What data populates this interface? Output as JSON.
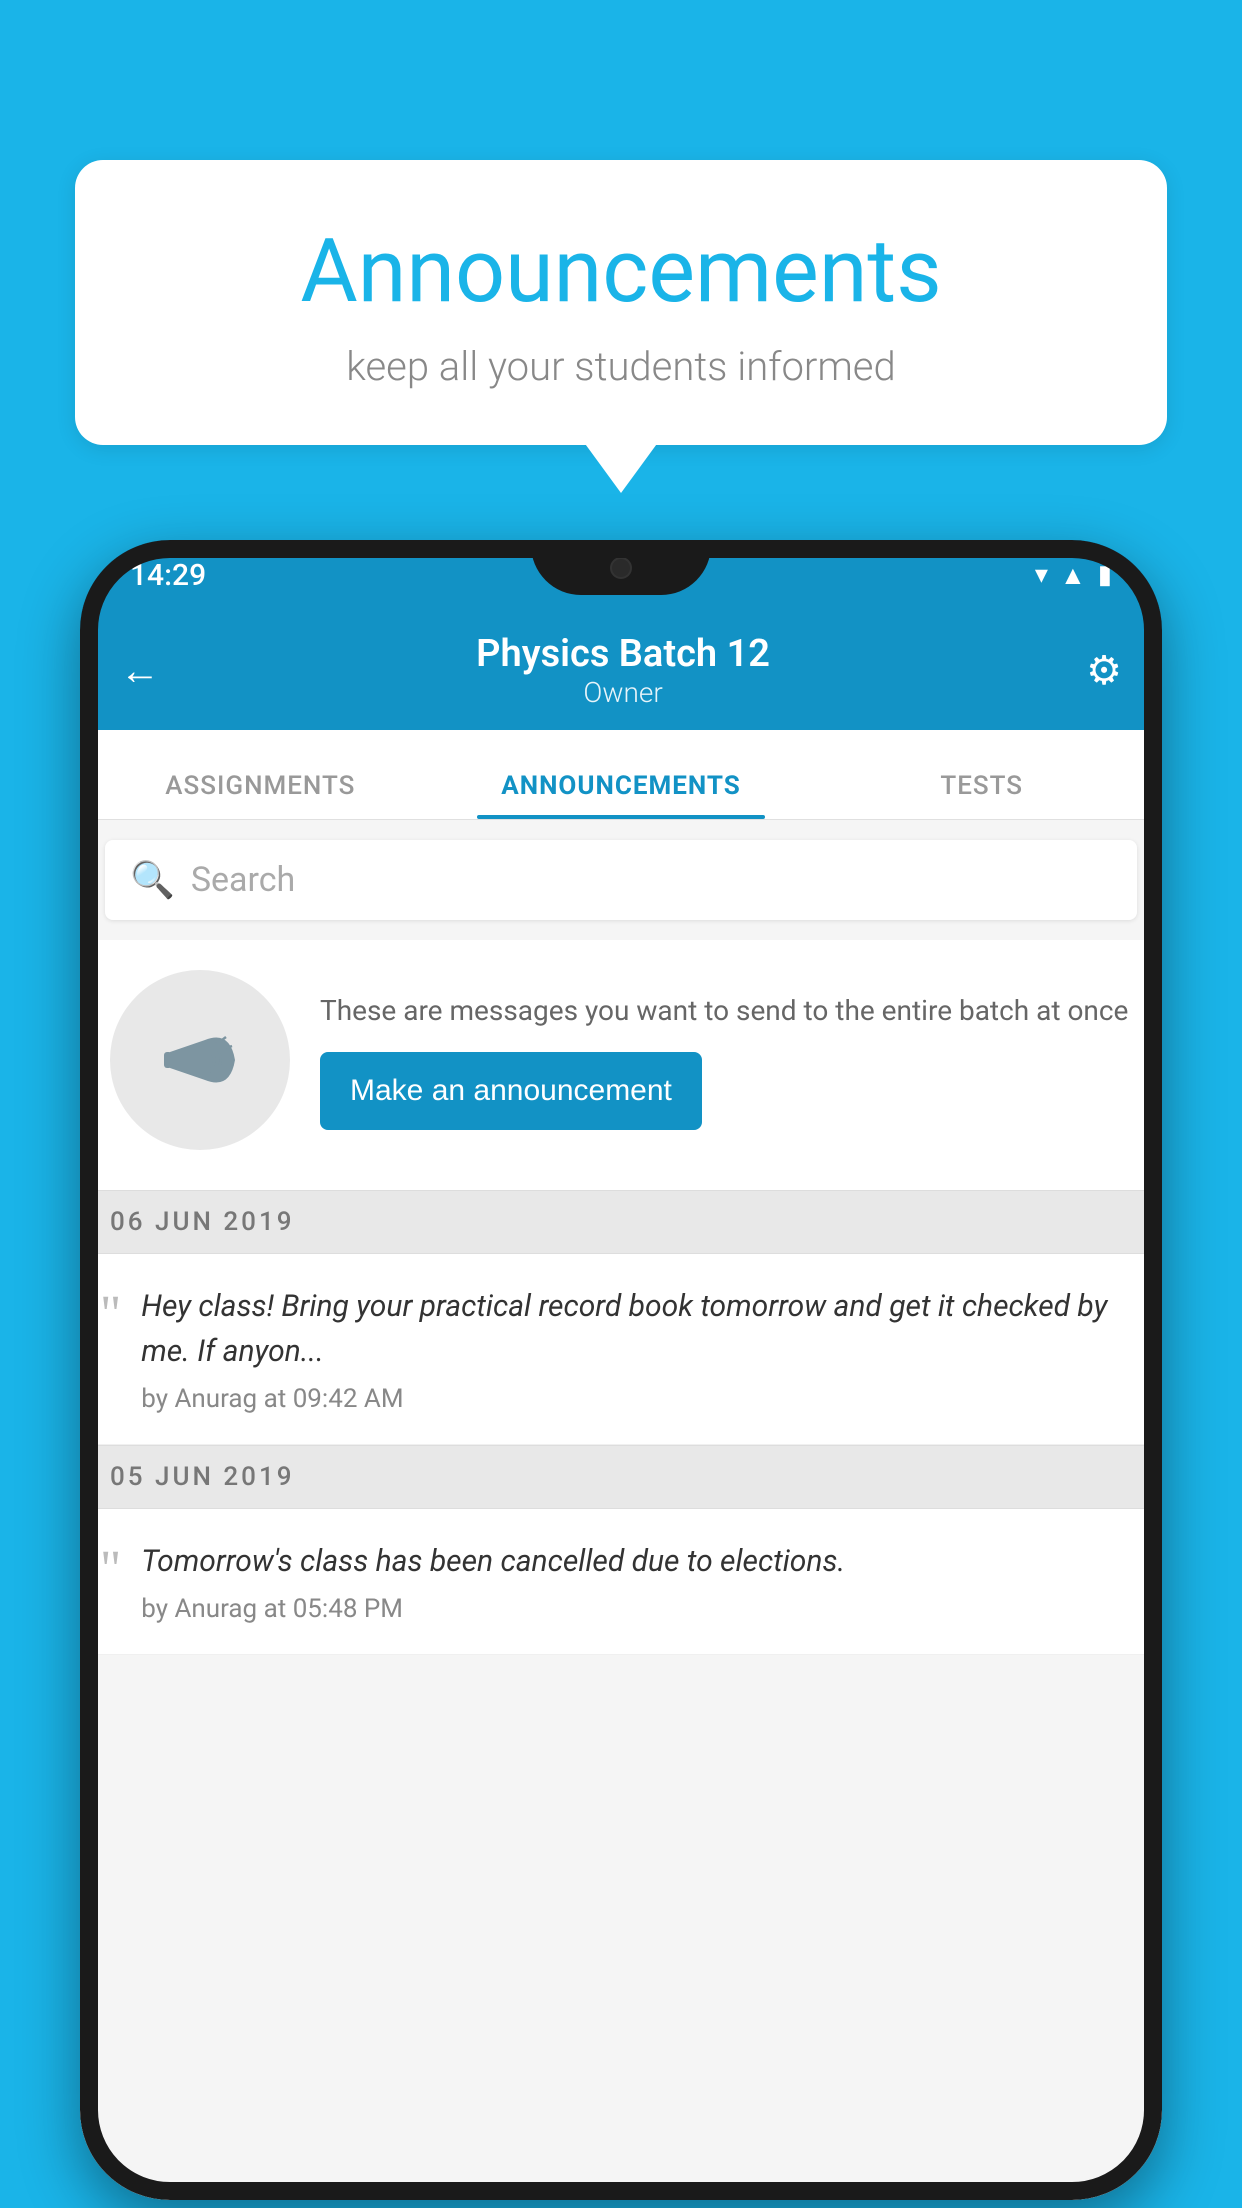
{
  "background_color": "#1ab4e8",
  "speech_bubble": {
    "title": "Announcements",
    "subtitle": "keep all your students informed"
  },
  "phone": {
    "status_bar": {
      "time": "14:29",
      "icons": [
        "wifi",
        "signal",
        "battery"
      ]
    },
    "header": {
      "back_label": "←",
      "title": "Physics Batch 12",
      "subtitle": "Owner",
      "settings_label": "⚙"
    },
    "tabs": [
      {
        "label": "ASSIGNMENTS",
        "active": false
      },
      {
        "label": "ANNOUNCEMENTS",
        "active": true
      },
      {
        "label": "TESTS",
        "active": false
      }
    ],
    "search": {
      "placeholder": "Search"
    },
    "promo": {
      "description": "These are messages you want to send to the entire batch at once",
      "button_label": "Make an announcement"
    },
    "announcements": [
      {
        "date": "06  JUN  2019",
        "message": "Hey class! Bring your practical record book tomorrow and get it checked by me. If anyon...",
        "meta": "by Anurag at 09:42 AM"
      },
      {
        "date": "05  JUN  2019",
        "message": "Tomorrow's class has been cancelled due to elections.",
        "meta": "by Anurag at 05:48 PM"
      }
    ]
  }
}
